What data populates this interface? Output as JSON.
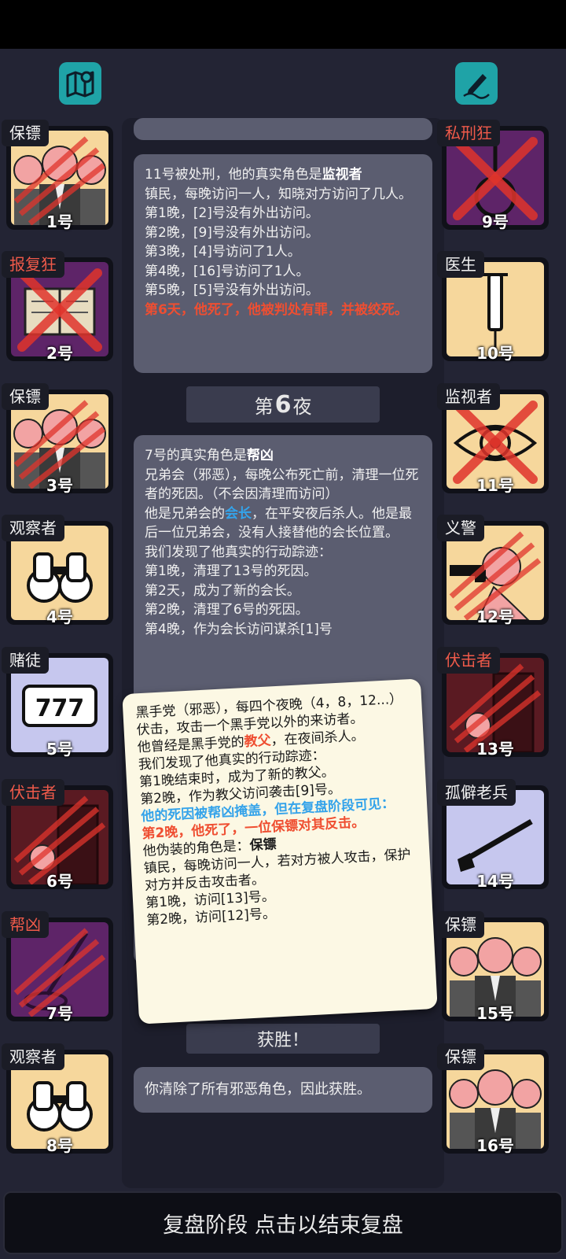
{
  "top": {
    "map_icon": "map-pin-icon",
    "notes_icon": "pen-note-icon"
  },
  "players_left": [
    {
      "role": "保镖",
      "num": "1号",
      "art": "bodyguard",
      "dead": true
    },
    {
      "role": "报复狂",
      "num": "2号",
      "art": "book",
      "dead": true
    },
    {
      "role": "保镖",
      "num": "3号",
      "art": "bodyguard",
      "dead": true
    },
    {
      "role": "观察者",
      "num": "4号",
      "art": "binoculars",
      "dead": false
    },
    {
      "role": "赌徒",
      "num": "5号",
      "art": "slot777",
      "dead": false
    },
    {
      "role": "伏击者",
      "num": "6号",
      "art": "ambusher",
      "dead": true
    },
    {
      "role": "帮凶",
      "num": "7号",
      "art": "mop",
      "dead": true
    },
    {
      "role": "观察者",
      "num": "8号",
      "art": "binoculars",
      "dead": false
    }
  ],
  "players_right": [
    {
      "role": "私刑狂",
      "num": "9号",
      "art": "noose",
      "dead": true
    },
    {
      "role": "医生",
      "num": "10号",
      "art": "syringe",
      "dead": false
    },
    {
      "role": "监视者",
      "num": "11号",
      "art": "eye",
      "dead": true
    },
    {
      "role": "义警",
      "num": "12号",
      "art": "vigilante",
      "dead": true
    },
    {
      "role": "伏击者",
      "num": "13号",
      "art": "ambusher",
      "dead": true
    },
    {
      "role": "孤僻老兵",
      "num": "14号",
      "art": "rifle",
      "dead": false
    },
    {
      "role": "保镖",
      "num": "15号",
      "art": "bodyguard",
      "dead": false
    },
    {
      "role": "保镖",
      "num": "16号",
      "art": "bodyguard",
      "dead": false
    }
  ],
  "log": {
    "card1": {
      "p1a": "11号被处刑，他的真实角色是",
      "p1b": "监视者",
      "l2": "镇民，每晚访问一人，知晓对方访问了几人。",
      "l3": "第1晚，[2]号没有外出访问。",
      "l4": "第2晚，[9]号没有外出访问。",
      "l5": "第3晚，[4]号访问了1人。",
      "l6": "第4晚，[16]号访问了1人。",
      "l7": "第5晚，[5]号没有外出访问。",
      "death": "第6天，他死了，他被判处有罪，并被绞死。"
    },
    "night_label_pre": "第",
    "night_label_num": "6",
    "night_label_post": "夜",
    "card2": {
      "p1a": "7号的真实角色是",
      "p1b": "帮凶",
      "l2": "兄弟会（邪恶），每晚公布死亡前，清理一位死者的死因。（不会因清理而访问）",
      "l3a": "他是兄弟会的",
      "l3b": "会长",
      "l3c": "，在平安夜后杀人。他是最后一位兄弟会，没有人接替他的会长位置。",
      "l4": "我们发现了他真实的行动踪迹：",
      "l5": "第1晚，清理了13号的死因。",
      "l6": "第2天，成为了新的会长。",
      "l7": "第2晚，清理了6号的死因。",
      "l8": "第4晚，作为会长访问谋杀[1]号"
    },
    "victory_label": "获胜！",
    "victory_text": "你清除了所有邪恶角色，因此获胜。"
  },
  "popup": {
    "l1": "黑手党（邪恶），每四个夜晚（4，8，12...）伏击，攻击一个黑手党以外的来访者。",
    "l2a": "他曾经是黑手党的",
    "l2b": "教父",
    "l2c": "，在夜间杀人。",
    "l3": "我们发现了他真实的行动踪迹：",
    "l4": "第1晚结束时，成为了新的教父。",
    "l5": "第2晚，作为教父访问袭击[9]号。",
    "blue": "他的死因被帮凶掩盖，但在复盘阶段可见：",
    "red": "第2晚，他死了，一位保镖对其反击。",
    "l6a": "他伪装的角色是：",
    "l6b": "保镖",
    "l7": "镇民，每晚访问一人，若对方被人攻击，保护对方并反击攻击者。",
    "l8": "第1晚，访问[13]号。",
    "l9": "第2晚，访问[12]号。"
  },
  "bottom": {
    "label": "复盘阶段 点击以结束复盘"
  },
  "colors": {
    "accent": "#1fa3a7",
    "evil_red": "#ef4e31",
    "info_blue": "#34a3ea",
    "purple_bg": "#5e2468",
    "tan_bg": "#f6d79c",
    "lavender_bg": "#c6c7ee",
    "maroon_bg": "#5a1a22"
  }
}
